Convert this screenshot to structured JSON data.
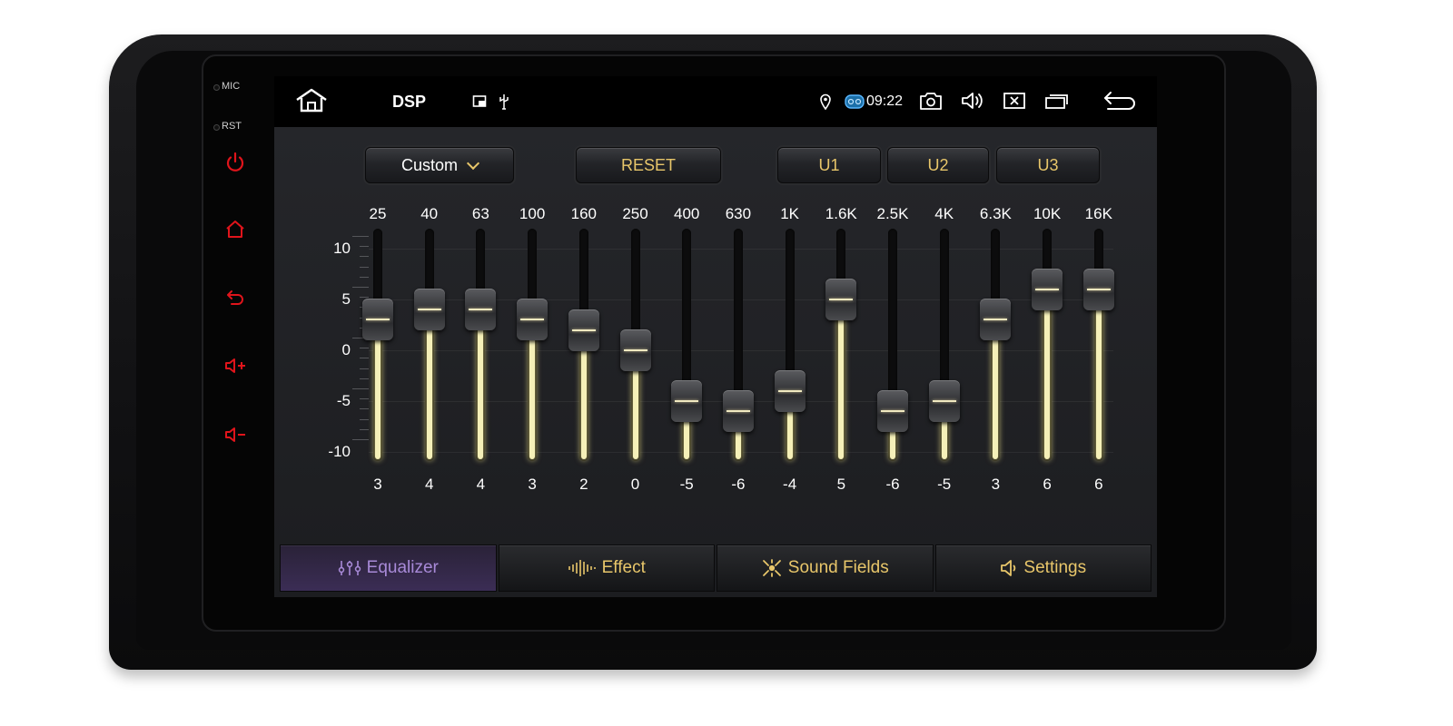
{
  "hardware": {
    "mic_label": "MIC",
    "rst_label": "RST",
    "icon_color": "#e0141b"
  },
  "statusbar": {
    "title": "DSP",
    "time": "09:22"
  },
  "controls": {
    "preset": "Custom",
    "reset_label": "RESET",
    "user_presets": [
      "U1",
      "U2",
      "U3"
    ]
  },
  "equalizer": {
    "scale_labels": [
      "10",
      "5",
      "0",
      "-5",
      "-10"
    ],
    "range": [
      -10,
      10
    ],
    "bands": [
      {
        "freq": "25",
        "gain": 3
      },
      {
        "freq": "40",
        "gain": 4
      },
      {
        "freq": "63",
        "gain": 4
      },
      {
        "freq": "100",
        "gain": 3
      },
      {
        "freq": "160",
        "gain": 2
      },
      {
        "freq": "250",
        "gain": 0
      },
      {
        "freq": "400",
        "gain": -5
      },
      {
        "freq": "630",
        "gain": -6
      },
      {
        "freq": "1K",
        "gain": -4
      },
      {
        "freq": "1.6K",
        "gain": 5
      },
      {
        "freq": "2.5K",
        "gain": -6
      },
      {
        "freq": "4K",
        "gain": -5
      },
      {
        "freq": "6.3K",
        "gain": 3
      },
      {
        "freq": "10K",
        "gain": 6
      },
      {
        "freq": "16K",
        "gain": 6
      }
    ]
  },
  "tabs": [
    {
      "label": "Equalizer",
      "active": true
    },
    {
      "label": "Effect",
      "active": false
    },
    {
      "label": "Sound Fields",
      "active": false
    },
    {
      "label": "Settings",
      "active": false
    }
  ]
}
